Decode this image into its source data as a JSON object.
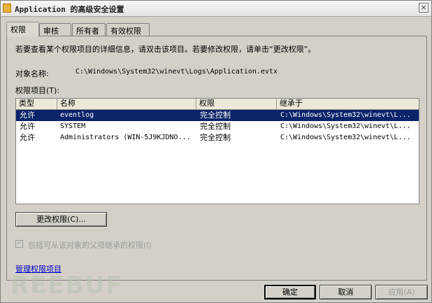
{
  "titlebar": {
    "title": "Application 的高级安全设置",
    "close_glyph": "×",
    "icon": "folder-icon"
  },
  "tabs": [
    {
      "label": "权限",
      "active": true
    },
    {
      "label": "审核"
    },
    {
      "label": "所有者"
    },
    {
      "label": "有效权限"
    }
  ],
  "permissions": {
    "description": "若要查看某个权限项目的详细信息，请双击该项目。若要修改权限，请单击“更改权限”。",
    "object_label": "对象名称:",
    "object_value": "C:\\Windows\\System32\\winevt\\Logs\\Application.evtx",
    "entries_label": "权限项目(T):",
    "columns": [
      "类型",
      "名称",
      "权限",
      "继承于"
    ],
    "rows": [
      {
        "type": "允许",
        "name": "eventlog",
        "permission": "完全控制",
        "inherited": "C:\\Windows\\System32\\winevt\\L...",
        "selected": true
      },
      {
        "type": "允许",
        "name": "SYSTEM",
        "permission": "完全控制",
        "inherited": "C:\\Windows\\System32\\winevt\\L..."
      },
      {
        "type": "允许",
        "name": "Administrators (WIN-5J9KJDNO...",
        "permission": "完全控制",
        "inherited": "C:\\Windows\\System32\\winevt\\L..."
      }
    ],
    "change_button": "更改权限(C)...",
    "inherit_checkbox": {
      "label": "包括可从该对象的父项继承的权限(I)",
      "checked": true,
      "enabled": false,
      "mark": "✓"
    },
    "manage_link": "管理权限项目"
  },
  "footer": {
    "ok": "确定",
    "cancel": "取消",
    "apply": "应用(A)"
  },
  "watermark": "REEBUF",
  "colors": {
    "selection": "#0a246a",
    "link": "#0000cc",
    "dialog_bg": "#d4d0c8"
  }
}
